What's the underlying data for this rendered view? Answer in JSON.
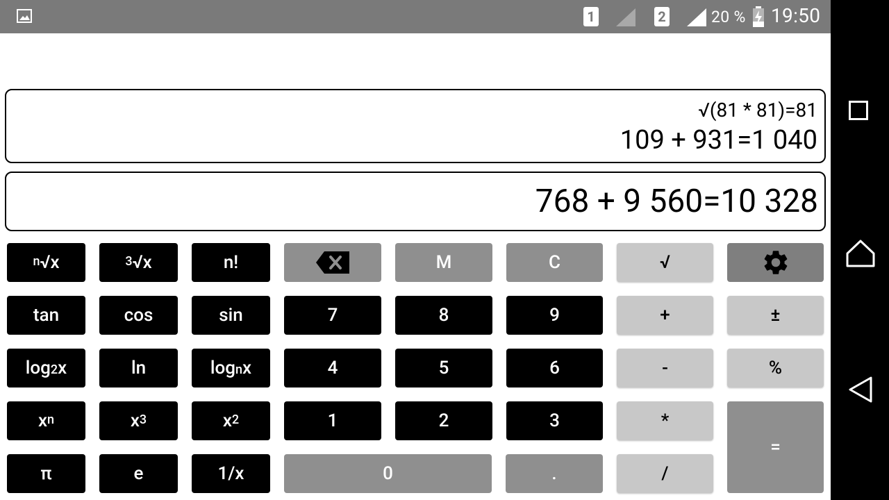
{
  "status_bar": {
    "sim1": "1",
    "sim2": "2",
    "battery_percent": "20 %",
    "time": "19:50"
  },
  "display": {
    "history": [
      "√(81 * 81)=81",
      "109 + 931=1 040"
    ],
    "current": "768 + 9 560=10 328"
  },
  "keys": {
    "nth_root": {
      "sup": "n",
      "main": "√x"
    },
    "cube_root": {
      "sup": "3",
      "main": "√x"
    },
    "factorial": "n!",
    "memory": "M",
    "clear": "C",
    "sqrt": "√",
    "tan": "tan",
    "cos": "cos",
    "sin": "sin",
    "d7": "7",
    "d8": "8",
    "d9": "9",
    "plus": "+",
    "plus_minus": "±",
    "log2": {
      "main": "log",
      "sub": "2",
      "tail": "x"
    },
    "ln": "ln",
    "logn": {
      "main": "log",
      "sub": "n",
      "tail": "x"
    },
    "d4": "4",
    "d5": "5",
    "d6": "6",
    "minus": "-",
    "percent": "%",
    "x_pow_n": {
      "main": "x",
      "sup": "n"
    },
    "x_cubed": {
      "main": "x",
      "sup": "3"
    },
    "x_squared": {
      "main": "x",
      "sup": "2"
    },
    "d1": "1",
    "d2": "2",
    "d3": "3",
    "multiply": "*",
    "equals": "=",
    "pi": "π",
    "e": "e",
    "reciprocal": "1/x",
    "d0": "0",
    "decimal": ".",
    "divide": "/"
  },
  "icons": {
    "backspace": "backspace-icon",
    "settings": "gear-icon"
  }
}
